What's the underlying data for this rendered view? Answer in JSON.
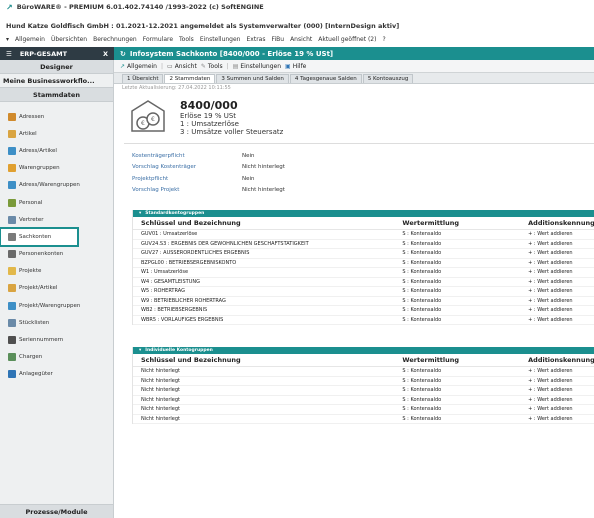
{
  "window": {
    "title": "BüroWARE® - PREMIUM 6.01.402.74140 /1993-2022 (c) SoftENGINE",
    "subtitle": "Hund Katze Goldfisch GmbH : 01.2021-12.2021 angemeldet als Systemverwalter (000) [InternDesign aktiv]"
  },
  "menubar": [
    "Allgemein",
    "Übersichten",
    "Berechnungen",
    "Formulare",
    "Tools",
    "Einstellungen",
    "Extras",
    "FiBu",
    "Ansicht",
    "Aktuell geöffnet (2)",
    "?"
  ],
  "sidebar": {
    "header": "ERP-GESAMT",
    "close": "X",
    "designer": "Designer",
    "workflow": "Meine Businessworkflo...",
    "stammdaten": "Stammdaten",
    "items": [
      {
        "label": "Adressen",
        "color": "#d08a2c"
      },
      {
        "label": "Artikel",
        "color": "#d9a441"
      },
      {
        "label": "Adress/Artikel",
        "color": "#3d8fc6"
      },
      {
        "label": "Warengruppen",
        "color": "#e0a030"
      },
      {
        "label": "Adress/Warengruppen",
        "color": "#3d8fc6"
      },
      {
        "label": "Personal",
        "color": "#7a9a3a"
      },
      {
        "label": "Vertreter",
        "color": "#6a8aa8"
      },
      {
        "label": "Sachkonten",
        "color": "#7b7b7b"
      },
      {
        "label": "Personenkonten",
        "color": "#6a6a6a"
      },
      {
        "label": "Projekte",
        "color": "#e2b84a"
      },
      {
        "label": "Projekt/Artikel",
        "color": "#d9a441"
      },
      {
        "label": "Projekt/Warengruppen",
        "color": "#3d8fc6"
      },
      {
        "label": "Stücklisten",
        "color": "#6a8aa8"
      },
      {
        "label": "Seriennummern",
        "color": "#4f4f4f"
      },
      {
        "label": "Chargen",
        "color": "#5a8f5a"
      },
      {
        "label": "Anlagegüter",
        "color": "#2e74b5"
      }
    ],
    "footer": "Prozesse/Module"
  },
  "main": {
    "header": "Infosystem Sachkonto [8400/000 - Erlöse 19 % USt]",
    "toolbar": [
      "Allgemein",
      "Ansicht",
      "Tools",
      "Einstellungen",
      "Hilfe"
    ],
    "tabs": [
      "1 Übersicht",
      "2 Stammdaten",
      "3 Summen und Salden",
      "4 Tagesgenaue Salden",
      "5 Kontoauszug"
    ],
    "last_update": "Letzte Aktualisierung: 27.04.2022 10:11:55",
    "account": {
      "number": "8400/000",
      "name": "Erlöse 19 % USt",
      "line1": "1 : Umsatzerlöse",
      "line2": "3 : Umsätze voller Steuersatz"
    },
    "properties": [
      {
        "key": "Kostenträgerpflicht",
        "value": "Nein"
      },
      {
        "key": "Vorschlag Kostenträger",
        "value": "Nicht hinterlegt"
      },
      {
        "key": "Projektpflicht",
        "value": "Nein"
      },
      {
        "key": "Vorschlag Projekt",
        "value": "Nicht hinterlegt"
      }
    ],
    "standard_group": {
      "title": "Standardkontogruppen",
      "columns": [
        "Schlüssel und Bezeichnung",
        "Wertermittlung",
        "Additionskennung"
      ],
      "rows": [
        [
          "GUV01 : Umsatzerlöse",
          "S : Kontensaldo",
          "+ : Wert addieren"
        ],
        [
          "GUV24.S3 : ERGEBNIS DER GEWÖHNLICHEN GESCHÄFTSTÄTIGKEIT",
          "S : Kontensaldo",
          "+ : Wert addieren"
        ],
        [
          "GUV27 : AUSSERORDENTLICHES ERGEBNIS",
          "S : Kontensaldo",
          "+ : Wert addieren"
        ],
        [
          "BZPGL00 : BETRIEBSERGEBNISKONTO",
          "S : Kontensaldo",
          "+ : Wert addieren"
        ],
        [
          "W1 : Umsatzerlöse",
          "S : Kontensaldo",
          "+ : Wert addieren"
        ],
        [
          "W4 : GESAMTLEISTUNG",
          "S : Kontensaldo",
          "+ : Wert addieren"
        ],
        [
          "W5 : ROHERTRAG",
          "S : Kontensaldo",
          "+ : Wert addieren"
        ],
        [
          "W9 : BETRIEBLICHER ROHERTRAG",
          "S : Kontensaldo",
          "+ : Wert addieren"
        ],
        [
          "WB2 : BETRIEBSERGEBNIS",
          "S : Kontensaldo",
          "+ : Wert addieren"
        ],
        [
          "WBR5 : VORLÄUFIGES ERGEBNIS",
          "S : Kontensaldo",
          "+ : Wert addieren"
        ]
      ]
    },
    "individual_group": {
      "title": "Individuelle Kontogruppen",
      "columns": [
        "Schlüssel und Bezeichnung",
        "Wertermittlung",
        "Additionskennung"
      ],
      "rows": [
        [
          "Nicht hinterlegt",
          "S : Kontensaldo",
          "+ : Wert addieren"
        ],
        [
          "Nicht hinterlegt",
          "S : Kontensaldo",
          "+ : Wert addieren"
        ],
        [
          "Nicht hinterlegt",
          "S : Kontensaldo",
          "+ : Wert addieren"
        ],
        [
          "Nicht hinterlegt",
          "S : Kontensaldo",
          "+ : Wert addieren"
        ],
        [
          "Nicht hinterlegt",
          "S : Kontensaldo",
          "+ : Wert addieren"
        ],
        [
          "Nicht hinterlegt",
          "S : Kontensaldo",
          "+ : Wert addieren"
        ]
      ]
    }
  }
}
